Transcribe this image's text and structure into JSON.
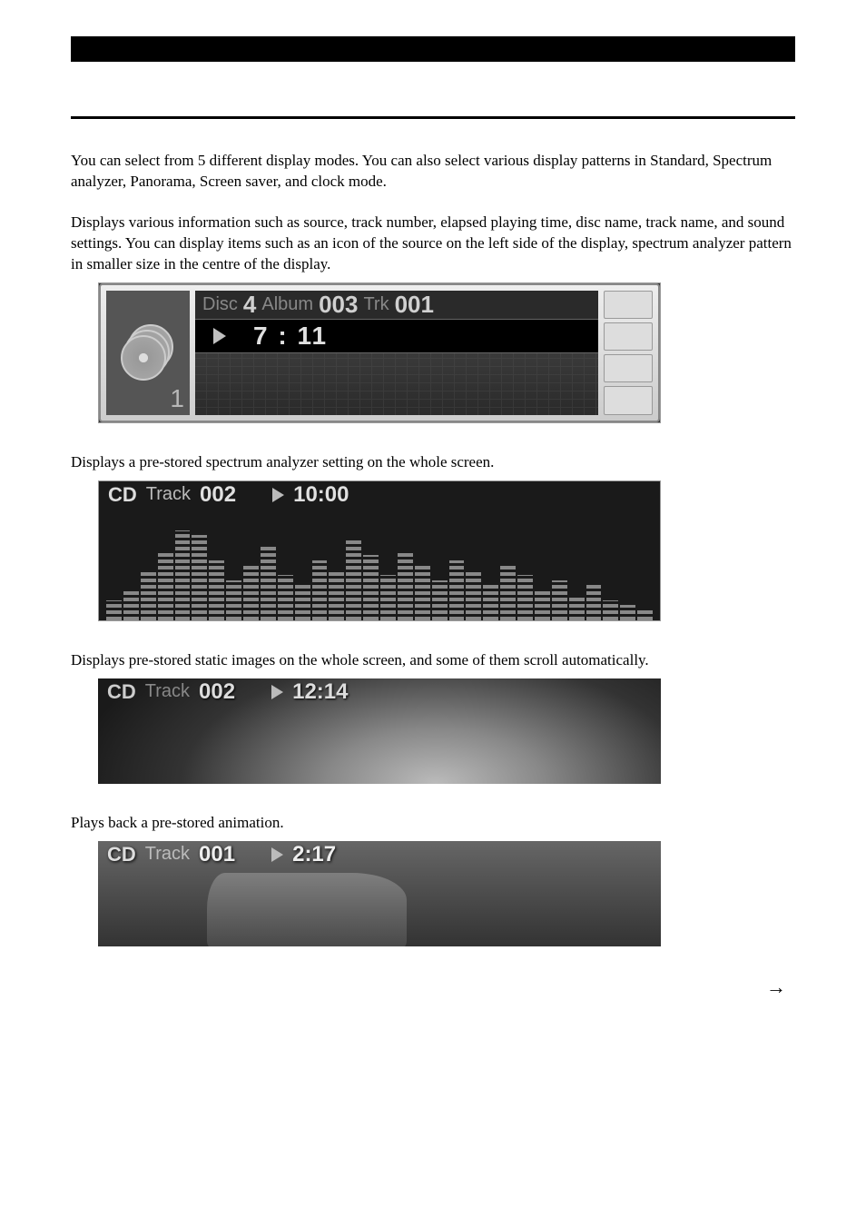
{
  "intro": "You can select from 5 different display modes. You can also select various display patterns in Standard, Spectrum analyzer, Panorama, Screen saver, and clock mode.",
  "standard": {
    "desc": "Displays various information such as source, track number, elapsed playing time, disc name, track name, and sound settings. You can display items such as an icon of the source on the left side of the display, spectrum analyzer pattern in smaller size in the centre of the display.",
    "disc_label": "Disc",
    "disc_val": "4",
    "album_label": "Album",
    "album_val": "003",
    "trk_label": "Trk",
    "trk_val": "001",
    "time": "7 : 11",
    "left_num": "1"
  },
  "spectrum": {
    "desc": "Displays a pre-stored spectrum analyzer setting on the whole screen.",
    "source": "CD",
    "track_label": "Track",
    "track_val": "002",
    "time": "10:00"
  },
  "panorama": {
    "desc": "Displays pre-stored static images on the whole screen, and some of them scroll automatically.",
    "source": "CD",
    "track_label": "Track",
    "track_val": "002",
    "time": "12:14"
  },
  "screensaver": {
    "desc": "Plays back a pre-stored animation.",
    "source": "CD",
    "track_label": "Track",
    "track_val": "001",
    "time": "2:17"
  },
  "continue": "→"
}
